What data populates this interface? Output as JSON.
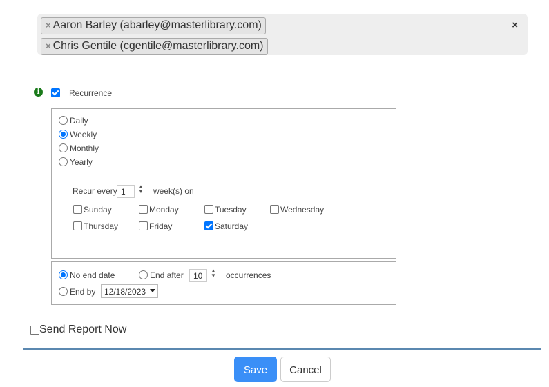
{
  "recipients": [
    {
      "remove": "×",
      "label": "Aaron Barley (abarley@masterlibrary.com)"
    },
    {
      "remove": "×",
      "label": "Chris Gentile (cgentile@masterlibrary.com)"
    }
  ],
  "clear_all": "×",
  "info_icon": "i",
  "recurrence": {
    "label": "Recurrence",
    "checked": true,
    "frequencies": [
      "Daily",
      "Weekly",
      "Monthly",
      "Yearly"
    ],
    "selected_frequency": "Weekly",
    "recur_every_label": "Recur every",
    "recur_every_value": "1",
    "recur_unit_label": "week(s) on",
    "days": [
      {
        "label": "Sunday",
        "checked": false
      },
      {
        "label": "Monday",
        "checked": false
      },
      {
        "label": "Tuesday",
        "checked": false
      },
      {
        "label": "Wednesday",
        "checked": false
      },
      {
        "label": "Thursday",
        "checked": false
      },
      {
        "label": "Friday",
        "checked": false
      },
      {
        "label": "Saturday",
        "checked": true
      }
    ]
  },
  "end": {
    "no_end_label": "No end date",
    "end_after_label": "End after",
    "occurrences_value": "10",
    "occurrences_label": "occurrences",
    "end_by_label": "End by",
    "end_by_date": "12/18/2023",
    "selected": "no_end"
  },
  "send_now": {
    "label": "Send Report Now",
    "checked": false
  },
  "buttons": {
    "save": "Save",
    "cancel": "Cancel"
  },
  "colors": {
    "accent": "#3a8ff7",
    "checkbox": "#0075ff",
    "info": "#1a7a1a",
    "divider": "#5b88b0"
  }
}
